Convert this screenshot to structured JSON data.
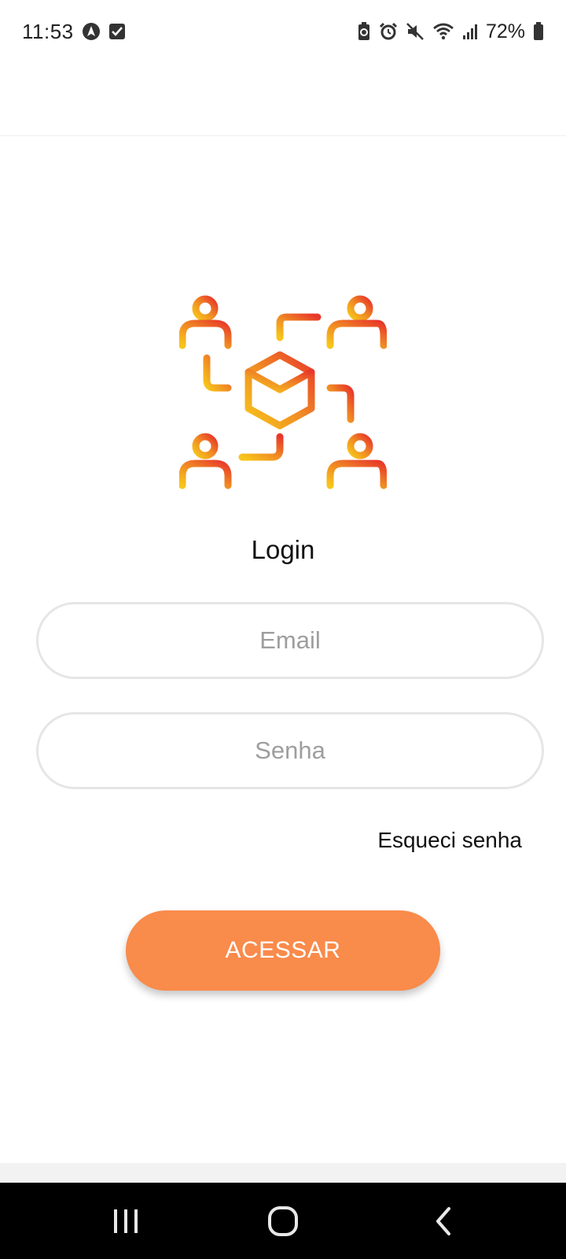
{
  "status_bar": {
    "time": "11:53",
    "battery": "72%"
  },
  "login": {
    "title": "Login",
    "email_placeholder": "Email",
    "password_placeholder": "Senha",
    "forgot_label": "Esqueci senha",
    "submit_label": "ACESSAR"
  },
  "colors": {
    "accent": "#f98b4b",
    "logo_gradient": [
      "#f7c51b",
      "#f08a24",
      "#e8382a"
    ]
  },
  "icons": {
    "logo": "network-people-cube-icon",
    "nav_recent": "recent-apps-icon",
    "nav_home": "home-icon",
    "nav_back": "back-icon"
  }
}
